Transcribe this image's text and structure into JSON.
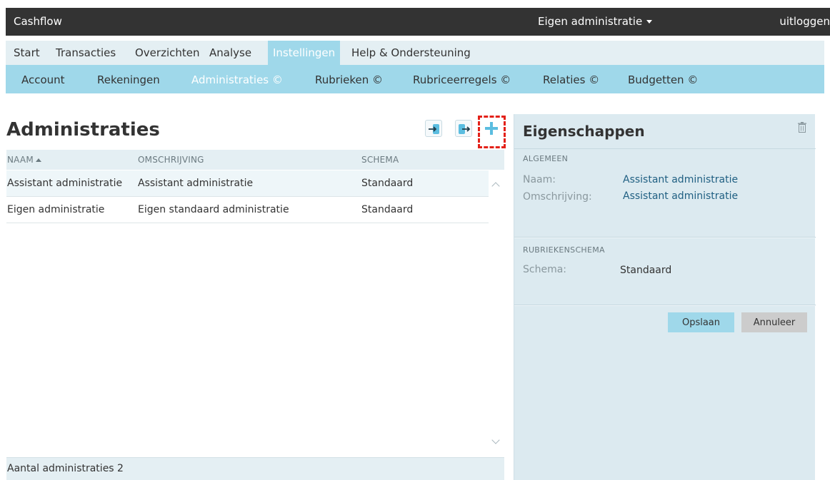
{
  "topbar": {
    "app_title": "Cashflow",
    "administration": "Eigen administratie",
    "logout": "uitloggen"
  },
  "main_nav": {
    "items": [
      "Start",
      "Transacties",
      "Overzichten",
      "Analyse",
      "Instellingen",
      "Help & Ondersteuning"
    ],
    "active": "Instellingen"
  },
  "sub_nav": {
    "items": [
      "Account",
      "Rekeningen",
      "Administraties ©",
      "Rubrieken ©",
      "Rubriceerregels ©",
      "Relaties ©",
      "Budgetten ©"
    ],
    "active": "Administraties ©"
  },
  "list": {
    "title": "Administraties",
    "columns": [
      "NAAM",
      "OMSCHRIJVING",
      "SCHEMA"
    ],
    "rows": [
      {
        "naam": "Assistant administratie",
        "omschrijving": "Assistant administratie",
        "schema": "Standaard"
      },
      {
        "naam": "Eigen administratie",
        "omschrijving": "Eigen standaard administratie",
        "schema": "Standaard"
      }
    ],
    "footer": "Aantal administraties 2"
  },
  "properties": {
    "title": "Eigenschappen",
    "general_header": "ALGEMEEN",
    "name_label": "Naam:",
    "name_value": "Assistant administratie",
    "description_label": "Omschrijving:",
    "description_value": "Assistant administratie",
    "schema_header": "RUBRIEKENSCHEMA",
    "schema_label": "Schema:",
    "schema_value": "Standaard",
    "save_label": "Opslaan",
    "cancel_label": "Annuleer"
  },
  "colors": {
    "topbar": "#333333",
    "menu_bg": "#e4eff3",
    "accent": "#9fd8ea",
    "highlight": "#e32119",
    "link": "#1f5f82"
  }
}
